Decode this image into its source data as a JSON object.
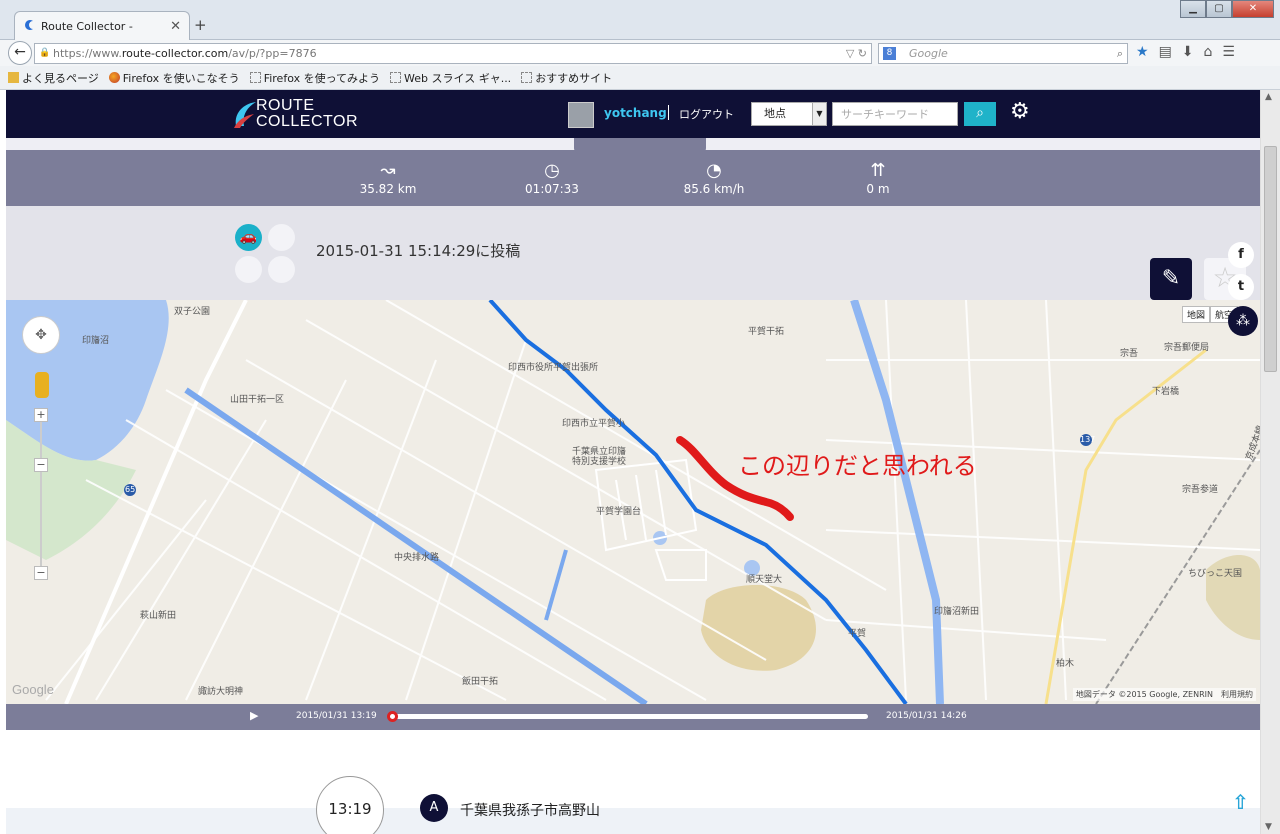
{
  "browser": {
    "tab_title": "Route Collector -",
    "url_prefix": "https://www.",
    "url_domain": "route-collector.com",
    "url_path": "/av/p/?pp=7876",
    "search_placeholder": "Google",
    "bookmarks": [
      "よく見るページ",
      "Firefox を使いこなそう",
      "Firefox を使ってみよう",
      "Web スライス ギャ...",
      "おすすめサイト"
    ]
  },
  "site": {
    "logo_line1": "ROUTE",
    "logo_line2": "COLLECTOR",
    "username": "yotchang",
    "logout_label": "ログアウト",
    "search_type": "地点",
    "keyword_placeholder": "サーチキーワード"
  },
  "stats": {
    "distance": "35.82 km",
    "duration": "01:07:33",
    "max_speed": "85.6 km/h",
    "elevation": "0 m"
  },
  "post": {
    "posted_at": "2015-01-31 15:14:29に投稿"
  },
  "map": {
    "annotation": "この辺りだと思われる",
    "labels": {
      "futago": "双子公園",
      "inbanuma": "印旛沼",
      "yamada": "山田干拓一区",
      "inzai_office": "印西市役所平賀出張所",
      "hiraga_kantaku": "平賀干拓",
      "hiraga_school": "印西市立平賀小",
      "special_school_1": "千葉県立印旛",
      "special_school_2": "特別支援学校",
      "hiraga_gakuen": "平賀学園台",
      "junten": "順天堂大",
      "chuo_drain": "中央排水路",
      "hagiyama": "萩山新田",
      "suwa": "諏訪大明神",
      "handa": "飯田干拓",
      "inbanuma_shinden": "印旛沼新田",
      "hiraga": "平賀",
      "kashiwagi": "柏木",
      "sogo": "宗吾",
      "sogo_post": "宗吾郵便局",
      "shimoiwa": "下岩橋",
      "sogo_sando": "宗吾参道",
      "chibikko": "ちびっこ天国",
      "keisei": "京成本線",
      "route137": "137",
      "route65": "65"
    },
    "type_map": "地図",
    "type_sat": "航空",
    "google": "Google",
    "attribution": "地図データ ©2015 Google, ZENRIN　利用規約"
  },
  "playback": {
    "start": "2015/01/31 13:19",
    "end": "2015/01/31 14:26",
    "progress": 0.0
  },
  "timeline": {
    "time": "13:19",
    "marker": "A",
    "location": "千葉県我孫子市高野山"
  },
  "colors": {
    "header_bg": "#0f1036",
    "stats_bg": "#7c7d99",
    "accent": "#1fb3c9",
    "route": "#1a6fe0",
    "annotation": "#e01a1a"
  }
}
